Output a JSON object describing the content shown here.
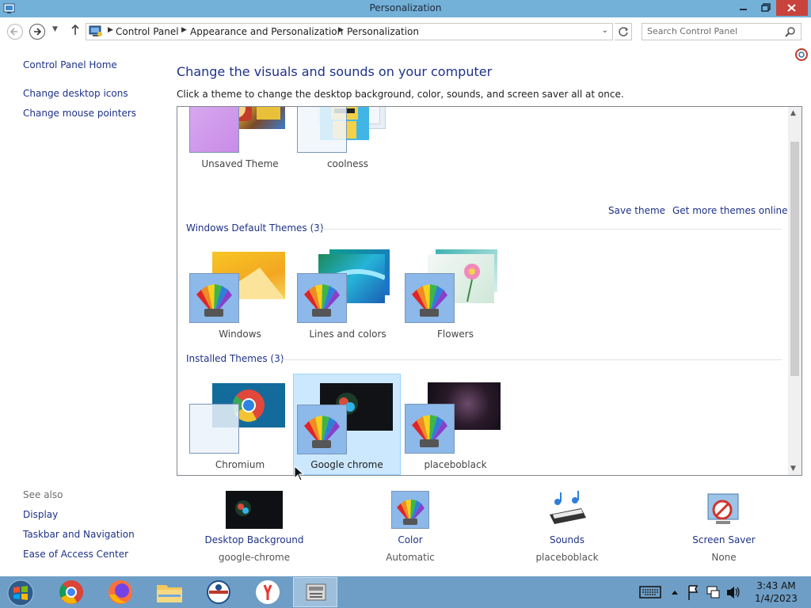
{
  "window": {
    "title": "Personalization"
  },
  "address": {
    "crumbs": [
      "Control Panel",
      "Appearance and Personalization",
      "Personalization"
    ],
    "search_placeholder": "Search Control Panel"
  },
  "left_pane": {
    "home": "Control Panel Home",
    "links": [
      "Change desktop icons",
      "Change mouse pointers"
    ],
    "see_also_title": "See also",
    "see_also": [
      "Display",
      "Taskbar and Navigation",
      "Ease of Access Center"
    ]
  },
  "main": {
    "heading": "Change the visuals and sounds on your computer",
    "subtext": "Click a theme to change the desktop background, color, sounds, and screen saver all at once.",
    "my_themes": [
      "Unsaved Theme",
      "coolness"
    ],
    "save_theme": "Save theme",
    "get_more": "Get more themes online",
    "default_group": "Windows Default Themes (3)",
    "default_themes": [
      "Windows",
      "Lines and colors",
      "Flowers"
    ],
    "installed_group": "Installed Themes (3)",
    "installed_themes": [
      "Chromium",
      "Google chrome",
      "placeboblack"
    ],
    "selected_theme": "Google chrome"
  },
  "settings": [
    {
      "label": "Desktop Background",
      "value": "google-chrome"
    },
    {
      "label": "Color",
      "value": "Automatic"
    },
    {
      "label": "Sounds",
      "value": "placeboblack"
    },
    {
      "label": "Screen Saver",
      "value": "None"
    }
  ],
  "taskbar": {
    "apps": [
      "start-button",
      "chrome-icon",
      "firefox-icon",
      "file-explorer-icon",
      "app-icon",
      "yandex-icon",
      "control-panel-icon"
    ],
    "time": "3:43 AM",
    "date": "1/4/2023"
  },
  "colors": {
    "titlebar": "#74b1d8",
    "link": "#1e3287",
    "close": "#c7433c",
    "taskbar": "#6e9ec6",
    "selection": "#cce8ff"
  }
}
